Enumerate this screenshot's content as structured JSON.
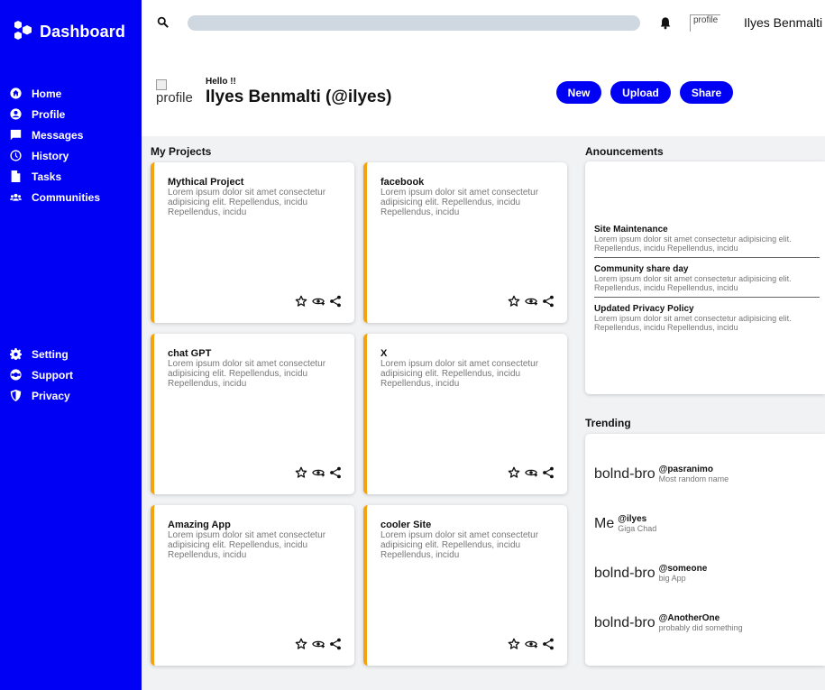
{
  "sidebar": {
    "brand": "Dashboard",
    "main_items": [
      {
        "label": "Home",
        "icon": "home-icon"
      },
      {
        "label": "Profile",
        "icon": "user-icon"
      },
      {
        "label": "Messages",
        "icon": "message-icon"
      },
      {
        "label": "History",
        "icon": "clock-icon"
      },
      {
        "label": "Tasks",
        "icon": "file-icon"
      },
      {
        "label": "Communities",
        "icon": "users-icon"
      }
    ],
    "bottom_items": [
      {
        "label": "Setting",
        "icon": "gear-icon"
      },
      {
        "label": "Support",
        "icon": "support-icon"
      },
      {
        "label": "Privacy",
        "icon": "shield-icon"
      }
    ],
    "color": "#0000f5"
  },
  "topbar": {
    "search_value": "",
    "avatar_alt": "profile",
    "username": "Ilyes Benmalti"
  },
  "header": {
    "avatar_alt": "profile",
    "greeting": "Hello !!",
    "name": "Ilyes Benmalti (@ilyes)",
    "buttons": {
      "new": "New",
      "upload": "Upload",
      "share": "Share"
    }
  },
  "projects": {
    "title": "My Projects",
    "items": [
      {
        "title": "Mythical Project",
        "desc": "Lorem ipsum dolor sit amet consectetur adipisicing elit. Repellendus, incidu Repellendus, incidu"
      },
      {
        "title": "facebook",
        "desc": "Lorem ipsum dolor sit amet consectetur adipisicing elit. Repellendus, incidu Repellendus, incidu"
      },
      {
        "title": "chat GPT",
        "desc": "Lorem ipsum dolor sit amet consectetur adipisicing elit. Repellendus, incidu Repellendus, incidu"
      },
      {
        "title": "X",
        "desc": "Lorem ipsum dolor sit amet consectetur adipisicing elit. Repellendus, incidu Repellendus, incidu"
      },
      {
        "title": "Amazing App",
        "desc": "Lorem ipsum dolor sit amet consectetur adipisicing elit. Repellendus, incidu Repellendus, incidu"
      },
      {
        "title": "cooler Site",
        "desc": "Lorem ipsum dolor sit amet consectetur adipisicing elit. Repellendus, incidu Repellendus, incidu"
      }
    ],
    "accent": "#f5a30c"
  },
  "announcements": {
    "title": "Anouncements",
    "items": [
      {
        "title": "Site Maintenance",
        "desc": "Lorem ipsum dolor sit amet consectetur adipisicing elit. Repellendus, incidu Repellendus, incidu"
      },
      {
        "title": "Community share day",
        "desc": "Lorem ipsum dolor sit amet consectetur adipisicing elit. Repellendus, incidu Repellendus, incidu"
      },
      {
        "title": "Updated Privacy Policy",
        "desc": "Lorem ipsum dolor sit amet consectetur adipisicing elit. Repellendus, incidu Repellendus, incidu"
      }
    ]
  },
  "trending": {
    "title": "Trending",
    "items": [
      {
        "img_alt": "bolnd-bro",
        "handle": "@pasranimo",
        "sub": "Most random name"
      },
      {
        "img_alt": "Me",
        "handle": "@ilyes",
        "sub": "Giga Chad"
      },
      {
        "img_alt": "bolnd-bro",
        "handle": "@someone",
        "sub": "big App"
      },
      {
        "img_alt": "bolnd-bro",
        "handle": "@AnotherOne",
        "sub": "probably did something"
      }
    ]
  }
}
